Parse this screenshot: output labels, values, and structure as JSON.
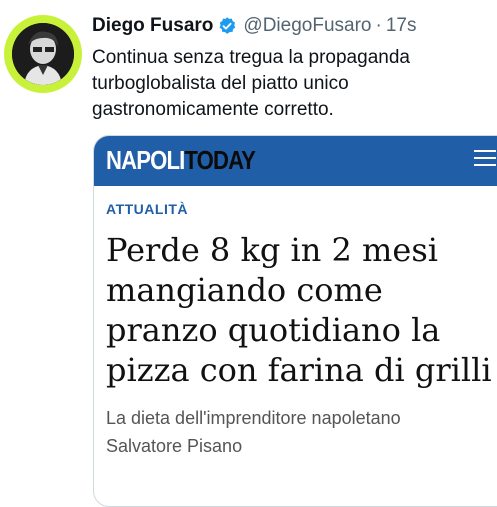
{
  "tweet": {
    "author_name": "Diego Fusaro",
    "handle": "@DiegoFusaro",
    "separator": "·",
    "time": "17s",
    "text": "Continua senza tregua la propaganda turboglobalista del piatto unico gastronomicamente corretto.",
    "avatar_ring_color": "#c8f23a",
    "verified_color": "#1d9bf0"
  },
  "card": {
    "logo_part1": "NAPOLI",
    "logo_part2": "TODAY",
    "header_color": "#215ea8",
    "section": "ATTUALITÀ",
    "headline_lines": [
      "Perde 8 kg in 2 mesi",
      "mangiando come",
      "pranzo quotidiano la",
      "pizza con farina di grilli"
    ],
    "subtitle_lines": [
      "La dieta dell'imprenditore napoletano",
      "Salvatore Pisano"
    ],
    "menu_icon": "hamburger-menu-icon"
  }
}
